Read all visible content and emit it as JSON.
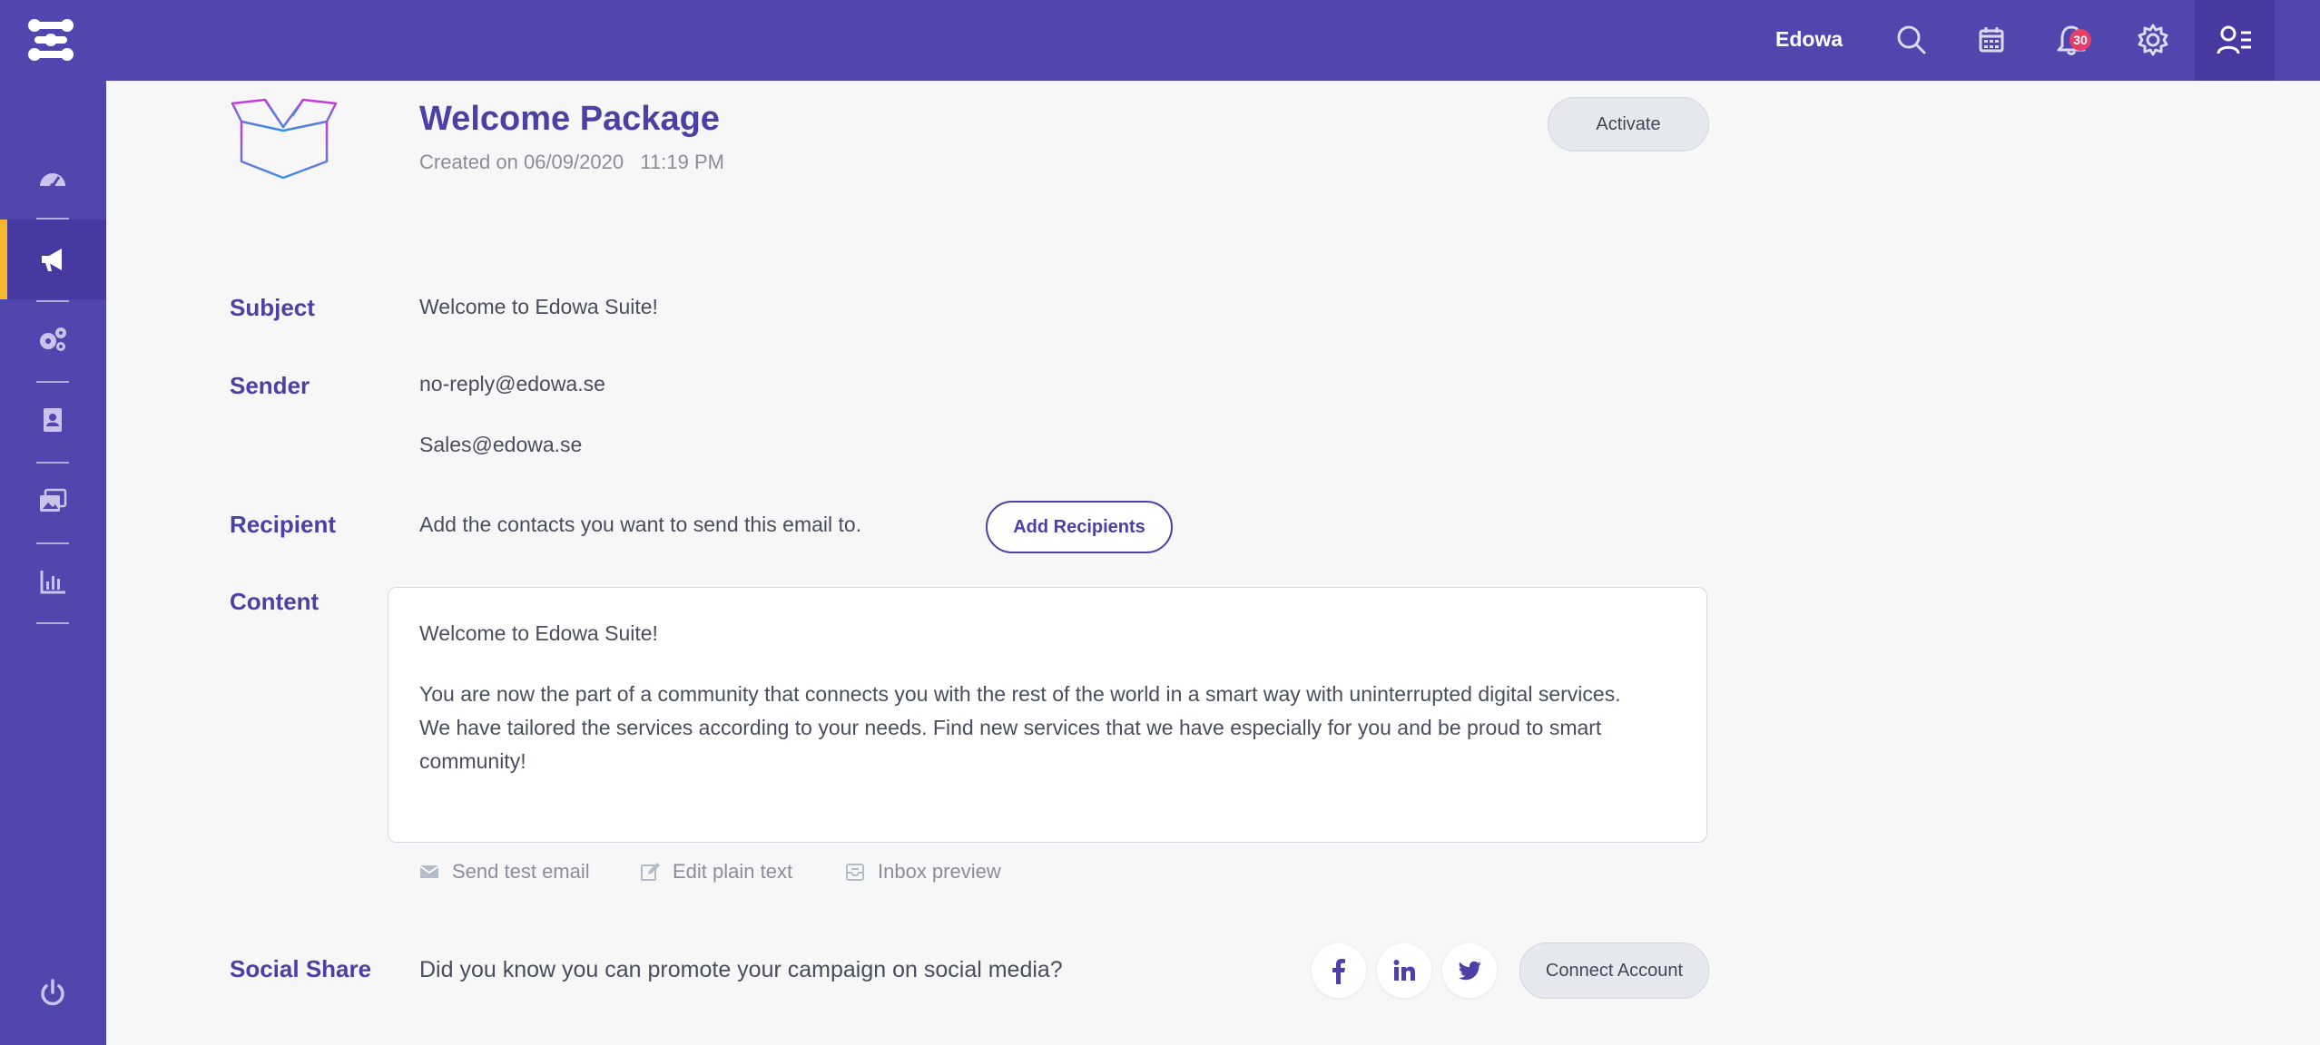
{
  "header": {
    "user_name": "Edowa",
    "notification_count": "30"
  },
  "package": {
    "title": "Welcome Package",
    "created": "Created on 06/09/2020   11:19 PM",
    "activate_label": "Activate"
  },
  "fields": {
    "subject_label": "Subject",
    "subject_value": "Welcome to Edowa Suite!",
    "sender_label": "Sender",
    "sender_values": [
      "no-reply@edowa.se",
      "Sales@edowa.se"
    ],
    "recipient_label": "Recipient",
    "recipient_text": "Add the contacts you want to send this email to.",
    "add_recipients_label": "Add Recipients",
    "content_label": "Content"
  },
  "content": {
    "greeting": "Welcome to Edowa Suite!",
    "paragraph1": "You are now the part of a community that connects you with the rest of the world in a smart way with uninterrupted digital services.",
    "paragraph2": "We have tailored the services according to your needs. Find new services that we have especially for you and be proud to smart community!"
  },
  "actions": {
    "send_test": "Send test email",
    "edit_plain": "Edit plain text",
    "inbox_preview": "Inbox preview"
  },
  "social": {
    "label": "Social Share",
    "text": "Did you know you can promote your campaign on social media?",
    "connect_label": "Connect Account"
  },
  "colors": {
    "brand": "#5146ad",
    "accent": "#f5b731",
    "badge": "#e53e6a"
  },
  "icons": [
    "app-logo-icon",
    "search-icon",
    "calendar-icon",
    "bell-icon",
    "gear-icon",
    "user-list-icon",
    "dashboard-icon",
    "megaphone-icon",
    "cogs-icon",
    "contact-book-icon",
    "images-icon",
    "bar-chart-icon",
    "power-icon",
    "box-icon",
    "envelope-icon",
    "edit-icon",
    "inbox-icon",
    "facebook-icon",
    "linkedin-icon",
    "twitter-icon"
  ]
}
